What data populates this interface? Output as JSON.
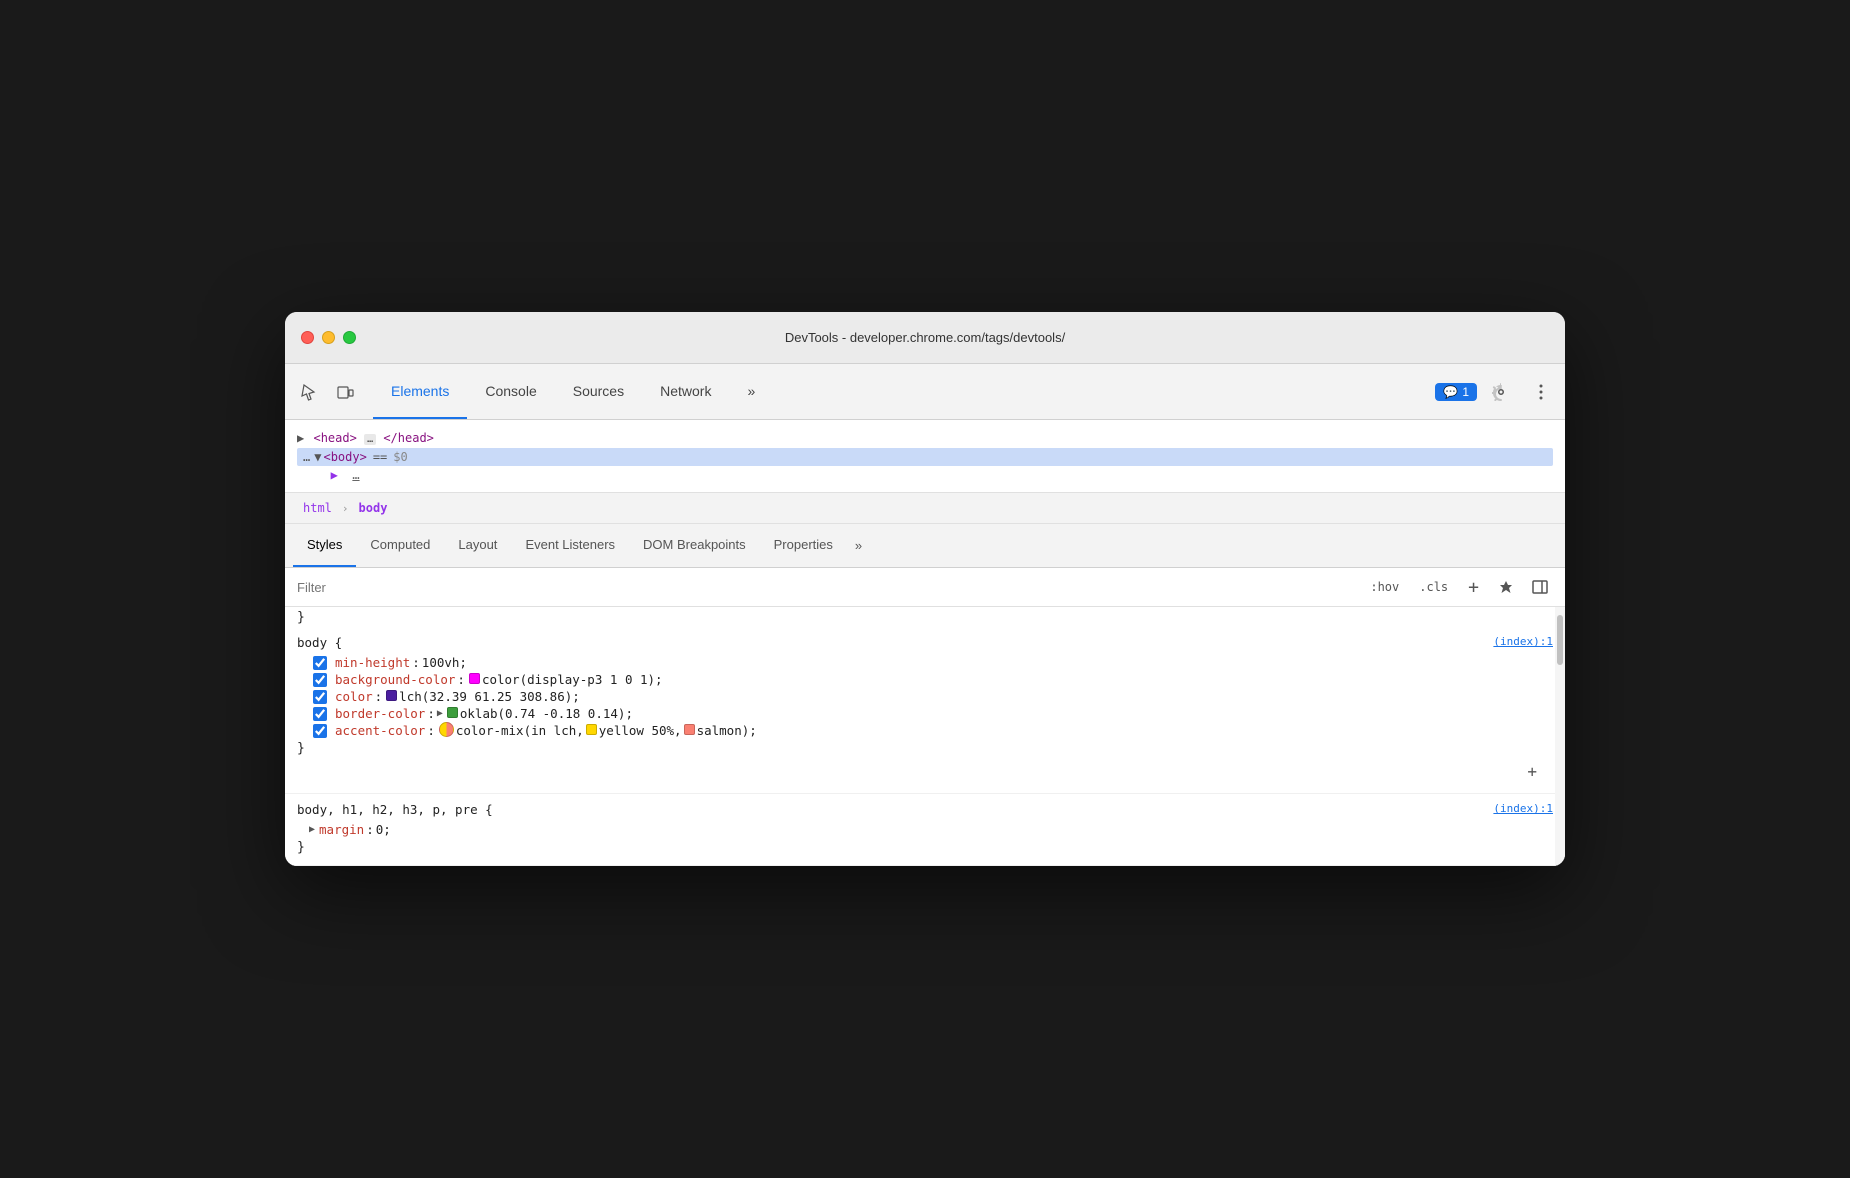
{
  "window": {
    "title": "DevTools - developer.chrome.com/tags/devtools/"
  },
  "titleBar": {
    "trafficLights": {
      "close": "close",
      "minimize": "minimize",
      "maximize": "maximize"
    }
  },
  "devtools": {
    "tabs": [
      {
        "label": "Elements",
        "active": true
      },
      {
        "label": "Console",
        "active": false
      },
      {
        "label": "Sources",
        "active": false
      },
      {
        "label": "Network",
        "active": false
      },
      {
        "label": "»",
        "active": false
      }
    ],
    "notification": "1",
    "icons": {
      "cursor": "⬚",
      "device": "□"
    }
  },
  "elementsPanel": {
    "headNode": "▶ <head> … </head>",
    "bodyNode": "… ▼ <body> == $0",
    "partialLine": "▶  …"
  },
  "breadcrumb": {
    "items": [
      {
        "label": "html",
        "active": false
      },
      {
        "label": "body",
        "active": true
      }
    ]
  },
  "stylesTabs": [
    {
      "label": "Styles",
      "active": true
    },
    {
      "label": "Computed",
      "active": false
    },
    {
      "label": "Layout",
      "active": false
    },
    {
      "label": "Event Listeners",
      "active": false
    },
    {
      "label": "DOM Breakpoints",
      "active": false
    },
    {
      "label": "Properties",
      "active": false
    },
    {
      "label": "»",
      "active": false
    }
  ],
  "filterBar": {
    "placeholder": "Filter",
    "hov": ":hov",
    "cls": ".cls",
    "add": "+",
    "icons": [
      "plus-icon",
      "flag-icon",
      "arrow-icon"
    ]
  },
  "cssRules": [
    {
      "id": "rule-body",
      "selector": "body {",
      "source": "(index):1",
      "properties": [
        {
          "checked": true,
          "name": "min-height",
          "value": "100vh;"
        },
        {
          "checked": true,
          "name": "background-color",
          "value": "color(display-p3 1 0 1);",
          "swatch": {
            "type": "solid",
            "color": "#ff00ff"
          }
        },
        {
          "checked": true,
          "name": "color",
          "value": "lch(32.39 61.25 308.86);",
          "swatch": {
            "type": "solid",
            "color": "#4b1ea0"
          }
        },
        {
          "checked": true,
          "name": "border-color",
          "value": "oklab(0.74 -0.18 0.14);",
          "swatch": {
            "type": "triangle-expand",
            "color": "#3d9e3d"
          }
        },
        {
          "checked": true,
          "name": "accent-color",
          "value": "color-mix(in lch,",
          "value2": "yellow 50%,",
          "value3": "salmon);",
          "swatch": {
            "type": "split",
            "color1": "#ffd700",
            "color2": "#fa8072"
          },
          "swatch2": {
            "type": "solid",
            "color": "#ffd700"
          },
          "swatch3": {
            "type": "solid",
            "color": "#fa8072"
          }
        }
      ],
      "closing": "}"
    },
    {
      "id": "rule-body-headings",
      "selector": "body, h1, h2, h3, p, pre {",
      "source": "(index):1",
      "properties": [
        {
          "name": "margin",
          "value": "0;",
          "expandable": true
        }
      ],
      "closing": "}"
    }
  ],
  "commaLine": "}",
  "colors": {
    "accent": "#1a73e8",
    "purple": "#9334ea",
    "red": "#c0392b",
    "magenta": "#ff00ff",
    "darkpurple": "#4b1ea0",
    "green": "#3d9e3d",
    "yellow": "#ffd700",
    "salmon": "#fa8072"
  }
}
